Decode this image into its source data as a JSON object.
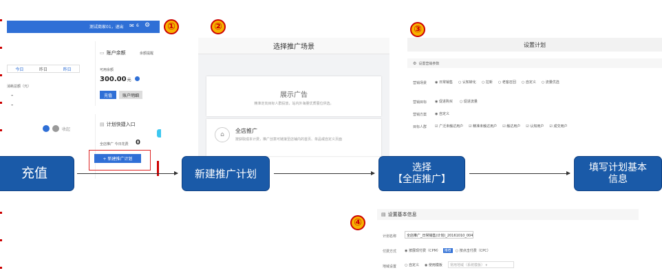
{
  "panel1": {
    "topbar_text": "测试商家01，退出",
    "topbar_badge": "6",
    "tabs": [
      "今日",
      "昨日",
      "昨日"
    ],
    "spend_label": "消耗总额（元）",
    "account_title": "账户余额",
    "account_link": "余额提醒",
    "available_label": "可用余额",
    "balance": "300.00",
    "balance_unit": "元",
    "recharge_btn": "充值",
    "detail_btn": "账户明细",
    "quick_title": "计划快捷入口",
    "store_promo_label": "全店推广 今日花费",
    "store_promo_value": "0",
    "new_plan_btn": "+ 新建推广计划",
    "misc": "收起"
  },
  "panel2": {
    "title": "选择推广场景",
    "ad_title": "展示广告",
    "ad_desc": "精准定向目标人群投放，站内外海量优质展位供选。",
    "store_title": "全店推广",
    "store_desc": "按获取成本计费，推广创意可链接至店铺内的首页、单品或自定义页面"
  },
  "panel3": {
    "title": "设置计划",
    "section": "设置营销参数",
    "row1_label": "营销场景",
    "row1_opts": [
      "日常销售",
      "认知转化",
      "拉新",
      "老客召回",
      "自定义",
      "流量优选"
    ],
    "row2_label": "营销目标",
    "row2_opts": [
      "促进购买",
      "促进流量"
    ],
    "row3_label": "营销方案",
    "row3_opts": [
      "自定义"
    ],
    "row4_label": "目标人群",
    "row4_opts": [
      "广泛未触达用户",
      "精准未触达用户",
      "触达用户",
      "认知用户",
      "成交用户"
    ]
  },
  "panel4": {
    "title": "设置基本信息",
    "name_label": "计划名称",
    "name_value": "全店推广_日常销售(计划)_20161010_004142",
    "pay_label": "付费方式",
    "pay_opt1": "按展现付费（CPM）",
    "pay_badge": "推荐",
    "pay_opt2": "按点击付费（CPC）",
    "region_label": "地域设置",
    "region_opt1": "自定义",
    "region_opt2": "使用模板",
    "region_placeholder": "常用地域（系统模板）"
  },
  "flow": {
    "step1": "充值",
    "step2": "新建推广计划",
    "step3": "选择\n【全店推广】",
    "step4": "填写计划基本\n信息"
  },
  "markers": [
    "①",
    "②",
    "③",
    "④"
  ],
  "colors": {
    "flow_blue": "#1a5aa8",
    "marker_orange": "#f6b200",
    "marker_red": "#cc0000",
    "ui_blue": "#2f6fd6"
  }
}
